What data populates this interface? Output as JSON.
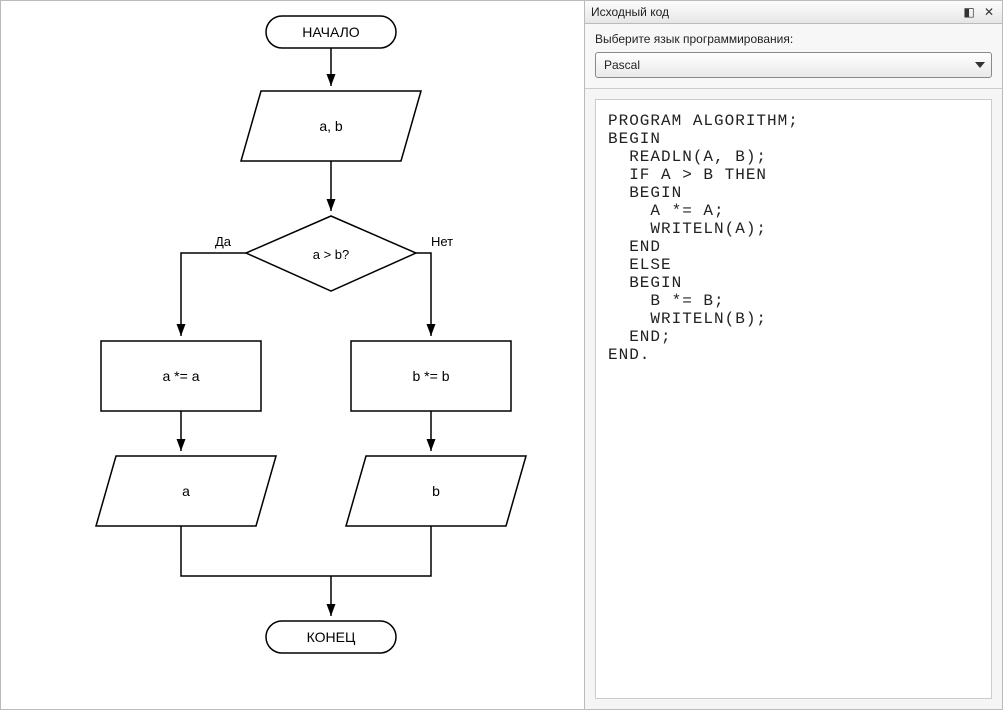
{
  "panel": {
    "title": "Исходный код",
    "lang_label": "Выберите язык программирования:",
    "selected_lang": "Pascal"
  },
  "flow": {
    "start": "НАЧАЛО",
    "input": "a, b",
    "cond": "a > b?",
    "yes": "Да",
    "no": "Нет",
    "left_proc": "a *= a",
    "right_proc": "b *= b",
    "left_out": "a",
    "right_out": "b",
    "end": "КОНЕЦ"
  },
  "code": "PROGRAM ALGORITHM;\nBEGIN\n  READLN(A, B);\n  IF A > B THEN\n  BEGIN\n    A *= A;\n    WRITELN(A);\n  END\n  ELSE\n  BEGIN\n    B *= B;\n    WRITELN(B);\n  END;\nEND."
}
